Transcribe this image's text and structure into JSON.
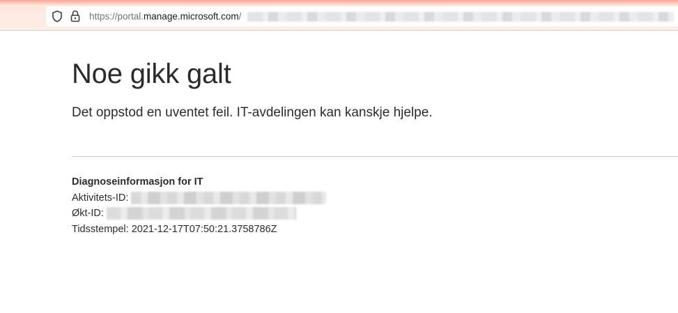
{
  "browser": {
    "url_prefix": "https://portal.",
    "url_domain": "manage.microsoft.com",
    "url_suffix": "/"
  },
  "page": {
    "title": "Noe gikk galt",
    "subtitle": "Det oppstod en uventet feil. IT-avdelingen kan kanskje hjelpe."
  },
  "diagnostics": {
    "heading": "Diagnoseinformasjon for IT",
    "activity_label": "Aktivitets-ID:",
    "session_label": "Økt-ID:",
    "timestamp_label": "Tidsstempel:",
    "timestamp_value": "2021-12-17T07:50:21.3758786Z"
  }
}
